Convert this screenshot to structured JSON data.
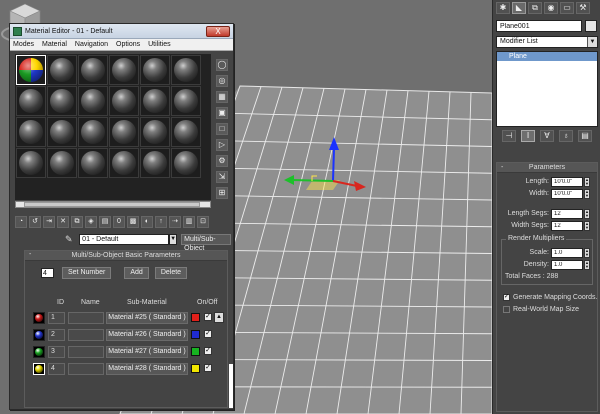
{
  "material_editor": {
    "title": "Material Editor - 01 - Default",
    "close_label": "X",
    "menu": [
      "Modes",
      "Material",
      "Navigation",
      "Options",
      "Utilities"
    ],
    "material_name": "01 - Default",
    "material_type": "Multi/Sub-Object",
    "rollout": {
      "title": "Multi/Sub-Object Basic Parameters",
      "collapse_glyph": "-",
      "num_materials": "4",
      "set_number_label": "Set Number",
      "add_label": "Add",
      "delete_label": "Delete",
      "columns": {
        "id": "ID",
        "name": "Name",
        "sub_material": "Sub-Material",
        "on_off": "On/Off"
      },
      "rows": [
        {
          "id": "1",
          "name": "",
          "sub_material": "Material #25  ( Standard )",
          "color": "#e0201a",
          "ball": "#cc1a1a",
          "on": true
        },
        {
          "id": "2",
          "name": "",
          "sub_material": "Material #26  ( Standard )",
          "color": "#1f2bd0",
          "ball": "#2233cc",
          "on": true
        },
        {
          "id": "3",
          "name": "",
          "sub_material": "Material #27  ( Standard )",
          "color": "#17b321",
          "ball": "#18a020",
          "on": true
        },
        {
          "id": "4",
          "name": "",
          "sub_material": "Material #28  ( Standard )",
          "color": "#f1e600",
          "ball": "#e3d600",
          "on": true
        }
      ]
    }
  },
  "command_panel": {
    "object_name": "Plane001",
    "modifier_list": "Modifier List",
    "stack_item": "Plane",
    "parameters": {
      "title": "Parameters",
      "collapse_glyph": "-",
      "length_label": "Length:",
      "length_value": "10'0.0\"",
      "width_label": "Width:",
      "width_value": "10'0.0\"",
      "length_segs_label": "Length Segs:",
      "length_segs_value": "12",
      "width_segs_label": "Width Segs:",
      "width_segs_value": "12",
      "render_multipliers_label": "Render Multipliers",
      "scale_label": "Scale:",
      "scale_value": "1.0",
      "density_label": "Density:",
      "density_value": "1.0",
      "total_faces": "Total Faces : 288",
      "gen_mapping_label": "Generate Mapping Coords.",
      "real_world_label": "Real-World Map Size"
    }
  }
}
